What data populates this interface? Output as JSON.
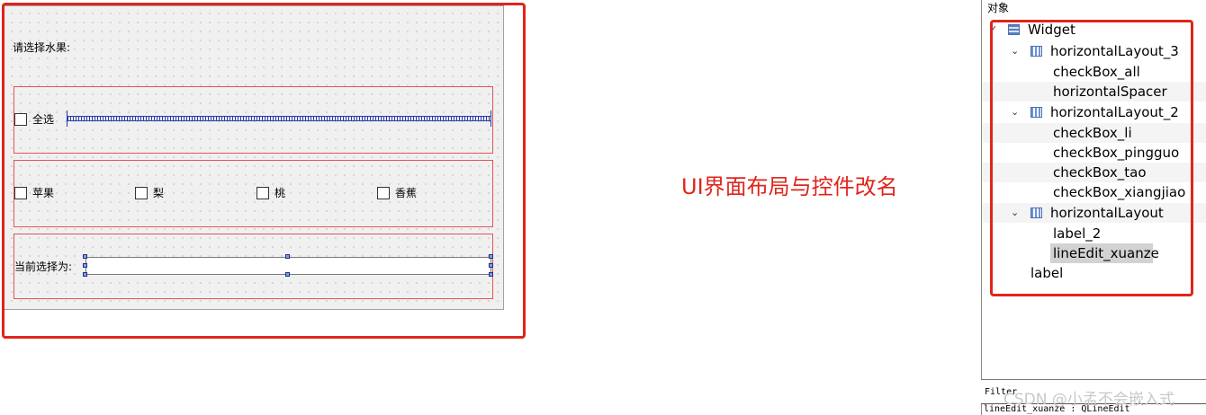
{
  "designer": {
    "prompt_label": "请选择水果:",
    "select_all": "全选",
    "fruits": [
      "苹果",
      "梨",
      "桃",
      "香蕉"
    ],
    "current_label": "当前选择为:",
    "lineedit_value": ""
  },
  "annotation": {
    "text": "UI界面布局与控件改名",
    "color": "#e0251c"
  },
  "inspector": {
    "header": "对象",
    "tree": [
      {
        "label": "Widget",
        "icon": "widget-icon",
        "expanded": true
      },
      {
        "label": "horizontalLayout_3",
        "icon": "layout-icon",
        "expanded": true
      },
      {
        "label": "checkBox_all"
      },
      {
        "label": "horizontalSpacer"
      },
      {
        "label": "horizontalLayout_2",
        "icon": "layout-icon",
        "expanded": true
      },
      {
        "label": "checkBox_li"
      },
      {
        "label": "checkBox_pingguo"
      },
      {
        "label": "checkBox_tao"
      },
      {
        "label": "checkBox_xiangjiao"
      },
      {
        "label": "horizontalLayout",
        "icon": "layout-icon",
        "expanded": true
      },
      {
        "label": "label_2"
      },
      {
        "label": "lineEdit_xuanze",
        "selected": true
      },
      {
        "label": "label"
      }
    ],
    "filter_label": "Filter",
    "status": "lineEdit_xuanze : QLineEdit"
  },
  "watermark": "CSDN @小孟不会嵌入式"
}
